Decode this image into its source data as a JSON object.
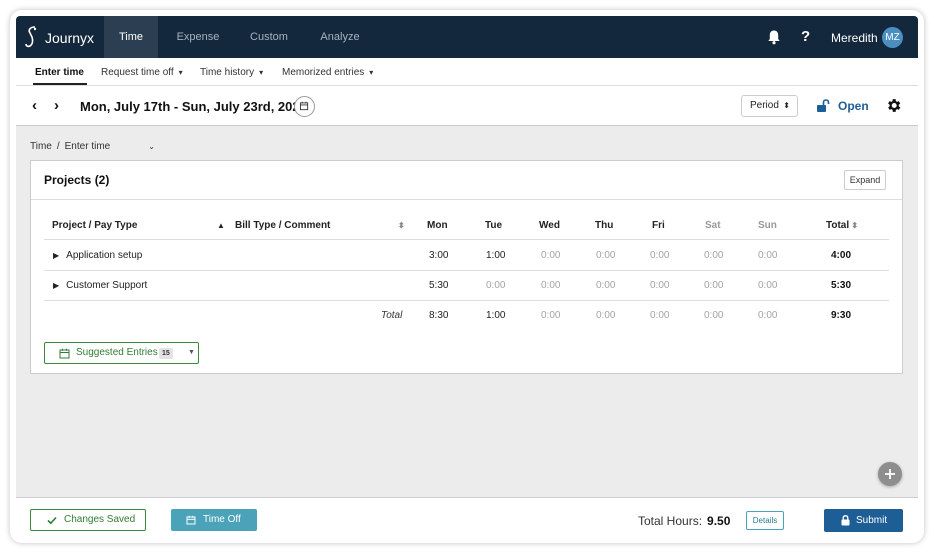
{
  "app": {
    "brand": "Journyx",
    "nav_tabs": [
      {
        "label": "Time",
        "active": true
      },
      {
        "label": "Expense",
        "active": false
      },
      {
        "label": "Custom",
        "active": false
      },
      {
        "label": "Analyze",
        "active": false
      }
    ],
    "help_label": "?",
    "user_name": "Meredith",
    "user_initials": "MZ"
  },
  "subnav": {
    "items": [
      {
        "label": "Enter time",
        "active": true,
        "has_dropdown": false
      },
      {
        "label": "Request time off",
        "caret": "▾"
      },
      {
        "label": "Time history",
        "caret": "▾"
      },
      {
        "label": "Memorized entries",
        "caret": "▾"
      }
    ]
  },
  "datebar": {
    "prev": "‹",
    "next": "›",
    "date_range": "Mon, July 17th - Sun, July 23rd, 2023",
    "period_label": "Period",
    "period_glyph": "⬍",
    "status_label": "Open"
  },
  "breadcrumb": {
    "root": "Time",
    "separator": "/",
    "current": "Enter time",
    "dropdown_glyph": "⌄"
  },
  "projects": {
    "title": "Projects (2)",
    "expand_label": "Expand",
    "headers": {
      "project": "Project / Pay Type",
      "bill": "Bill Type / Comment",
      "days": [
        "Mon",
        "Tue",
        "Wed",
        "Thu",
        "Fri",
        "Sat",
        "Sun"
      ],
      "total": "Total"
    },
    "rows": [
      {
        "name": "Application setup",
        "values": [
          "3:00",
          "1:00",
          "0:00",
          "0:00",
          "0:00",
          "0:00",
          "0:00"
        ],
        "total": "4:00"
      },
      {
        "name": "Customer Support",
        "values": [
          "5:30",
          "0:00",
          "0:00",
          "0:00",
          "0:00",
          "0:00",
          "0:00"
        ],
        "total": "5:30"
      }
    ],
    "totals": {
      "label": "Total",
      "values": [
        "8:30",
        "1:00",
        "0:00",
        "0:00",
        "0:00",
        "0:00",
        "0:00"
      ],
      "total": "9:30"
    },
    "suggested_label": "Suggested Entries",
    "suggested_count": "15"
  },
  "footer": {
    "changes_saved": "Changes Saved",
    "time_off": "Time Off",
    "total_hours_label": "Total Hours:",
    "total_hours_value": "9.50",
    "details_label": "Details",
    "submit_label": "Submit"
  }
}
